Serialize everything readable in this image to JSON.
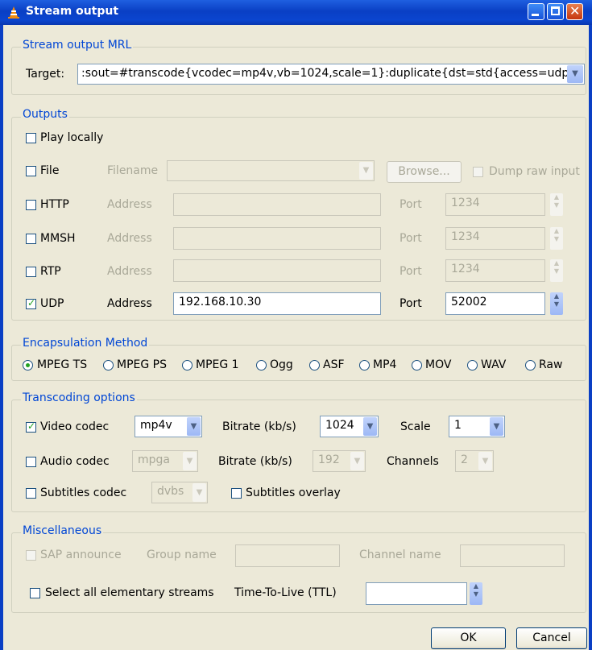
{
  "window": {
    "title": "Stream output"
  },
  "mrl": {
    "legend": "Stream output MRL",
    "target_label": "Target:",
    "target_value": ":sout=#transcode{vcodec=mp4v,vb=1024,scale=1}:duplicate{dst=std{access=udp,"
  },
  "outputs": {
    "legend": "Outputs",
    "play_locally": "Play locally",
    "file": {
      "label": "File",
      "filename_label": "Filename",
      "browse": "Browse...",
      "dump_raw": "Dump raw input"
    },
    "http": {
      "label": "HTTP",
      "address_label": "Address",
      "port_label": "Port",
      "port": "1234"
    },
    "mmsh": {
      "label": "MMSH",
      "address_label": "Address",
      "port_label": "Port",
      "port": "1234"
    },
    "rtp": {
      "label": "RTP",
      "address_label": "Address",
      "port_label": "Port",
      "port": "1234"
    },
    "udp": {
      "label": "UDP",
      "address_label": "Address",
      "address": "192.168.10.30",
      "port_label": "Port",
      "port": "52002",
      "checked": true
    }
  },
  "encapsulation": {
    "legend": "Encapsulation Method",
    "options": [
      "MPEG TS",
      "MPEG PS",
      "MPEG 1",
      "Ogg",
      "ASF",
      "MP4",
      "MOV",
      "WAV",
      "Raw"
    ],
    "selected": "MPEG TS"
  },
  "transcoding": {
    "legend": "Transcoding options",
    "video_label": "Video codec",
    "video_codec": "mp4v",
    "video_bitrate_label": "Bitrate (kb/s)",
    "video_bitrate": "1024",
    "scale_label": "Scale",
    "scale": "1",
    "audio_label": "Audio codec",
    "audio_codec": "mpga",
    "audio_bitrate_label": "Bitrate (kb/s)",
    "audio_bitrate": "192",
    "channels_label": "Channels",
    "channels": "2",
    "subtitles_label": "Subtitles codec",
    "subtitles_codec": "dvbs",
    "subtitles_overlay": "Subtitles overlay"
  },
  "misc": {
    "legend": "Miscellaneous",
    "sap": "SAP announce",
    "group_name": "Group name",
    "channel_name": "Channel name",
    "select_all": "Select all elementary streams",
    "ttl_label": "Time-To-Live (TTL)"
  },
  "buttons": {
    "ok": "OK",
    "cancel": "Cancel"
  },
  "colors": {
    "titlebar": "#0a3fc4",
    "legend_text": "#0046d5",
    "check": "#21a121"
  }
}
